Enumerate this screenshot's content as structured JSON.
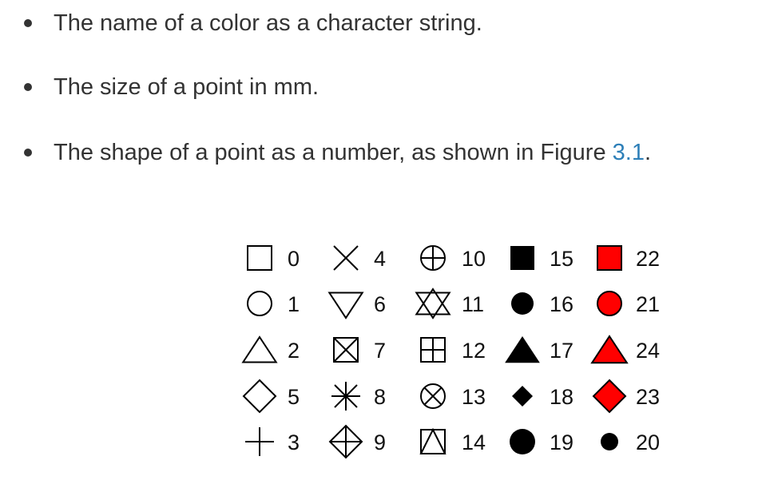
{
  "bullets": [
    {
      "text": "The name of a color as a character string."
    },
    {
      "text": "The size of a point in mm."
    },
    {
      "text_before": "The shape of a point as a number, as shown in Figure ",
      "link": "3.1",
      "text_after": "."
    }
  ],
  "figure": {
    "colors": {
      "outline": "#000000",
      "fill": "#ff0000"
    },
    "columns": [
      [
        {
          "code": "0",
          "shape": "open-square"
        },
        {
          "code": "1",
          "shape": "open-circle"
        },
        {
          "code": "2",
          "shape": "open-triangle"
        },
        {
          "code": "5",
          "shape": "open-diamond"
        },
        {
          "code": "3",
          "shape": "plus"
        }
      ],
      [
        {
          "code": "4",
          "shape": "cross"
        },
        {
          "code": "6",
          "shape": "open-triangle-down"
        },
        {
          "code": "7",
          "shape": "square-cross"
        },
        {
          "code": "8",
          "shape": "asterisk"
        },
        {
          "code": "9",
          "shape": "diamond-plus"
        }
      ],
      [
        {
          "code": "10",
          "shape": "circle-plus"
        },
        {
          "code": "11",
          "shape": "star-of-david"
        },
        {
          "code": "12",
          "shape": "square-plus"
        },
        {
          "code": "13",
          "shape": "circle-cross"
        },
        {
          "code": "14",
          "shape": "square-triangle"
        }
      ],
      [
        {
          "code": "15",
          "shape": "filled-square"
        },
        {
          "code": "16",
          "shape": "filled-circle"
        },
        {
          "code": "17",
          "shape": "filled-triangle"
        },
        {
          "code": "18",
          "shape": "filled-diamond-small"
        },
        {
          "code": "19",
          "shape": "filled-circle-large"
        }
      ],
      [
        {
          "code": "22",
          "shape": "red-square"
        },
        {
          "code": "21",
          "shape": "red-circle"
        },
        {
          "code": "24",
          "shape": "red-triangle"
        },
        {
          "code": "23",
          "shape": "red-diamond"
        },
        {
          "code": "20",
          "shape": "filled-circle-small"
        }
      ]
    ]
  }
}
